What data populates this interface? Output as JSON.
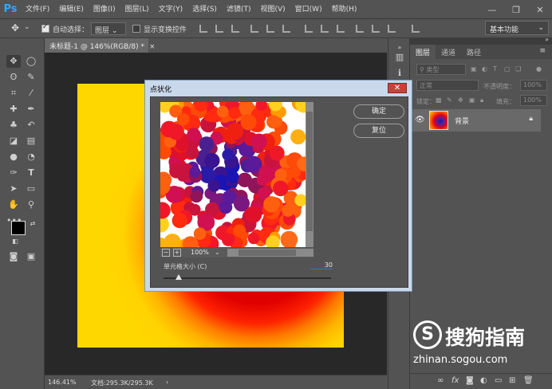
{
  "app": {
    "logo": "Ps",
    "menu": [
      "文件(F)",
      "编辑(E)",
      "图像(I)",
      "图层(L)",
      "文字(Y)",
      "选择(S)",
      "滤镜(T)",
      "视图(V)",
      "窗口(W)",
      "帮助(H)"
    ]
  },
  "options": {
    "auto_select_label": "自动选择：",
    "auto_select_target": "图层",
    "show_transform_label": "显示变换控件",
    "workspace": "基本功能"
  },
  "document": {
    "tab_title": "未标题-1 @ 146%(RGB/8) *",
    "zoom_status": "146.41%",
    "doc_size": "文档:295.3K/295.3K"
  },
  "layers_panel": {
    "tabs": [
      "图层",
      "通道",
      "路径"
    ],
    "filter_placeholder": "类型",
    "blend_mode": "正常",
    "opacity_label": "不透明度：",
    "opacity_value": "100%",
    "lock_label": "锁定：",
    "fill_label": "填充：",
    "fill_value": "100%",
    "layers": [
      {
        "name": "背景",
        "visible": true,
        "locked": true
      }
    ]
  },
  "dialog": {
    "title": "点状化",
    "ok_label": "确定",
    "reset_label": "复位",
    "zoom_value": "100%",
    "cell_size_label": "单元格大小 (C)",
    "cell_size_value": "30",
    "cell_size_fraction": 0.09
  },
  "watermark": {
    "logo": "S",
    "brand": "搜狗指南",
    "url": "zhinan.sogou.com"
  },
  "colors": {
    "ps_blue": "#31a8ff",
    "dialog_frame": "#c9d8ea",
    "close_red": "#c8423c"
  }
}
